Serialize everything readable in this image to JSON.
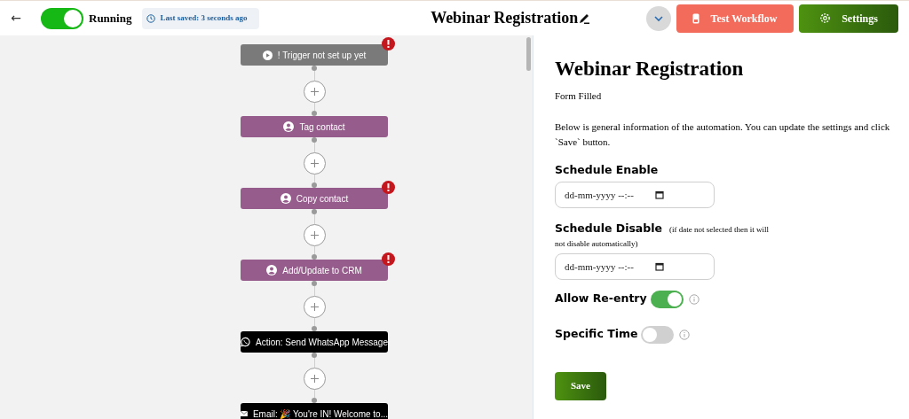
{
  "header": {
    "back": "←",
    "running": {
      "on": true,
      "label": "Running"
    },
    "last_saved": "Last saved: 3 seconds ago",
    "title": "Webinar Registration",
    "test_button": "Test Workflow",
    "settings_button": "Settings"
  },
  "flow": [
    {
      "kind": "trigger",
      "label": "! Trigger not set up yet",
      "error": true
    },
    {
      "kind": "contact",
      "label": "Tag contact",
      "error": false
    },
    {
      "kind": "contact",
      "label": "Copy contact",
      "error": true
    },
    {
      "kind": "contact",
      "label": "Add/Update to CRM",
      "error": true
    },
    {
      "kind": "whatsapp",
      "label": "Action: Send WhatsApp Message",
      "error": false
    },
    {
      "kind": "email",
      "label": "Email: 🎉 You're IN! Welcome to...",
      "error": false
    }
  ],
  "panel": {
    "title": "Webinar Registration",
    "subtitle": "Form Filled",
    "description": "Below is general information of the automation. You can update the settings and click `Save` button.",
    "fields": [
      {
        "kind": "date",
        "label": "Schedule Enable",
        "placeholder": "dd-mm-yyyy --:--"
      },
      {
        "kind": "date",
        "label": "Schedule Disable",
        "note_lines": [
          "(if date not selected then it will",
          "not disable automatically)"
        ],
        "placeholder": "dd-mm-yyyy --:--"
      },
      {
        "kind": "toggle",
        "label": "Allow Re-entry",
        "on": true
      },
      {
        "kind": "toggle",
        "label": "Specific Time",
        "on": false
      }
    ],
    "save_button": "Save"
  }
}
